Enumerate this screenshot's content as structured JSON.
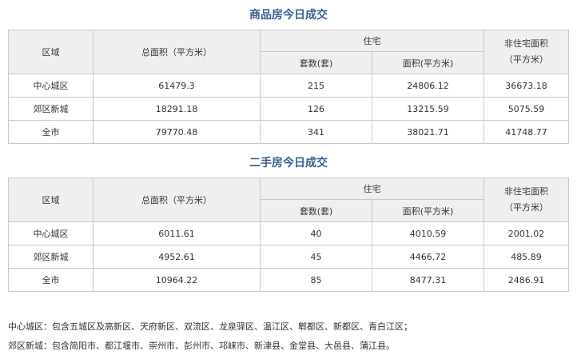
{
  "new_house": {
    "title": "商品房今日成交",
    "headers": {
      "region": "区域",
      "total_area": "总面积（平方米）",
      "residential": "住宅",
      "units": "套数(套)",
      "res_area": "面积(平方米)",
      "non_res_line1": "非住宅面积",
      "non_res_line2": "（平方米）"
    },
    "rows": [
      {
        "region": "中心城区",
        "total_area": "61479.3",
        "units": "215",
        "res_area": "24806.12",
        "non_res_area": "36673.18"
      },
      {
        "region": "郊区新城",
        "total_area": "18291.18",
        "units": "126",
        "res_area": "13215.59",
        "non_res_area": "5075.59"
      },
      {
        "region": "全市",
        "total_area": "79770.48",
        "units": "341",
        "res_area": "38021.71",
        "non_res_area": "41748.77"
      }
    ]
  },
  "second_hand": {
    "title": "二手房今日成交",
    "headers": {
      "region": "区域",
      "total_area": "总面积（平方米）",
      "residential": "住宅",
      "units": "套数(套)",
      "res_area": "面积(平方米)",
      "non_res_line1": "非住宅面积",
      "non_res_line2": "（平方米）"
    },
    "rows": [
      {
        "region": "中心城区",
        "total_area": "6011.61",
        "units": "40",
        "res_area": "4010.59",
        "non_res_area": "2001.02"
      },
      {
        "region": "郊区新城",
        "total_area": "4952.61",
        "units": "45",
        "res_area": "4466.72",
        "non_res_area": "485.89"
      },
      {
        "region": "全市",
        "total_area": "10964.22",
        "units": "85",
        "res_area": "8477.31",
        "non_res_area": "2486.91"
      }
    ]
  },
  "notes": {
    "center": "中心城区：包含五城区及高新区、天府新区、双流区、龙泉驿区、温江区、郫都区、新都区、青白江区；",
    "suburb": "郊区新城：包含简阳市、都江堰市、崇州市、彭州市、邛崃市、新津县、金堂县、大邑县、蒲江县。"
  }
}
